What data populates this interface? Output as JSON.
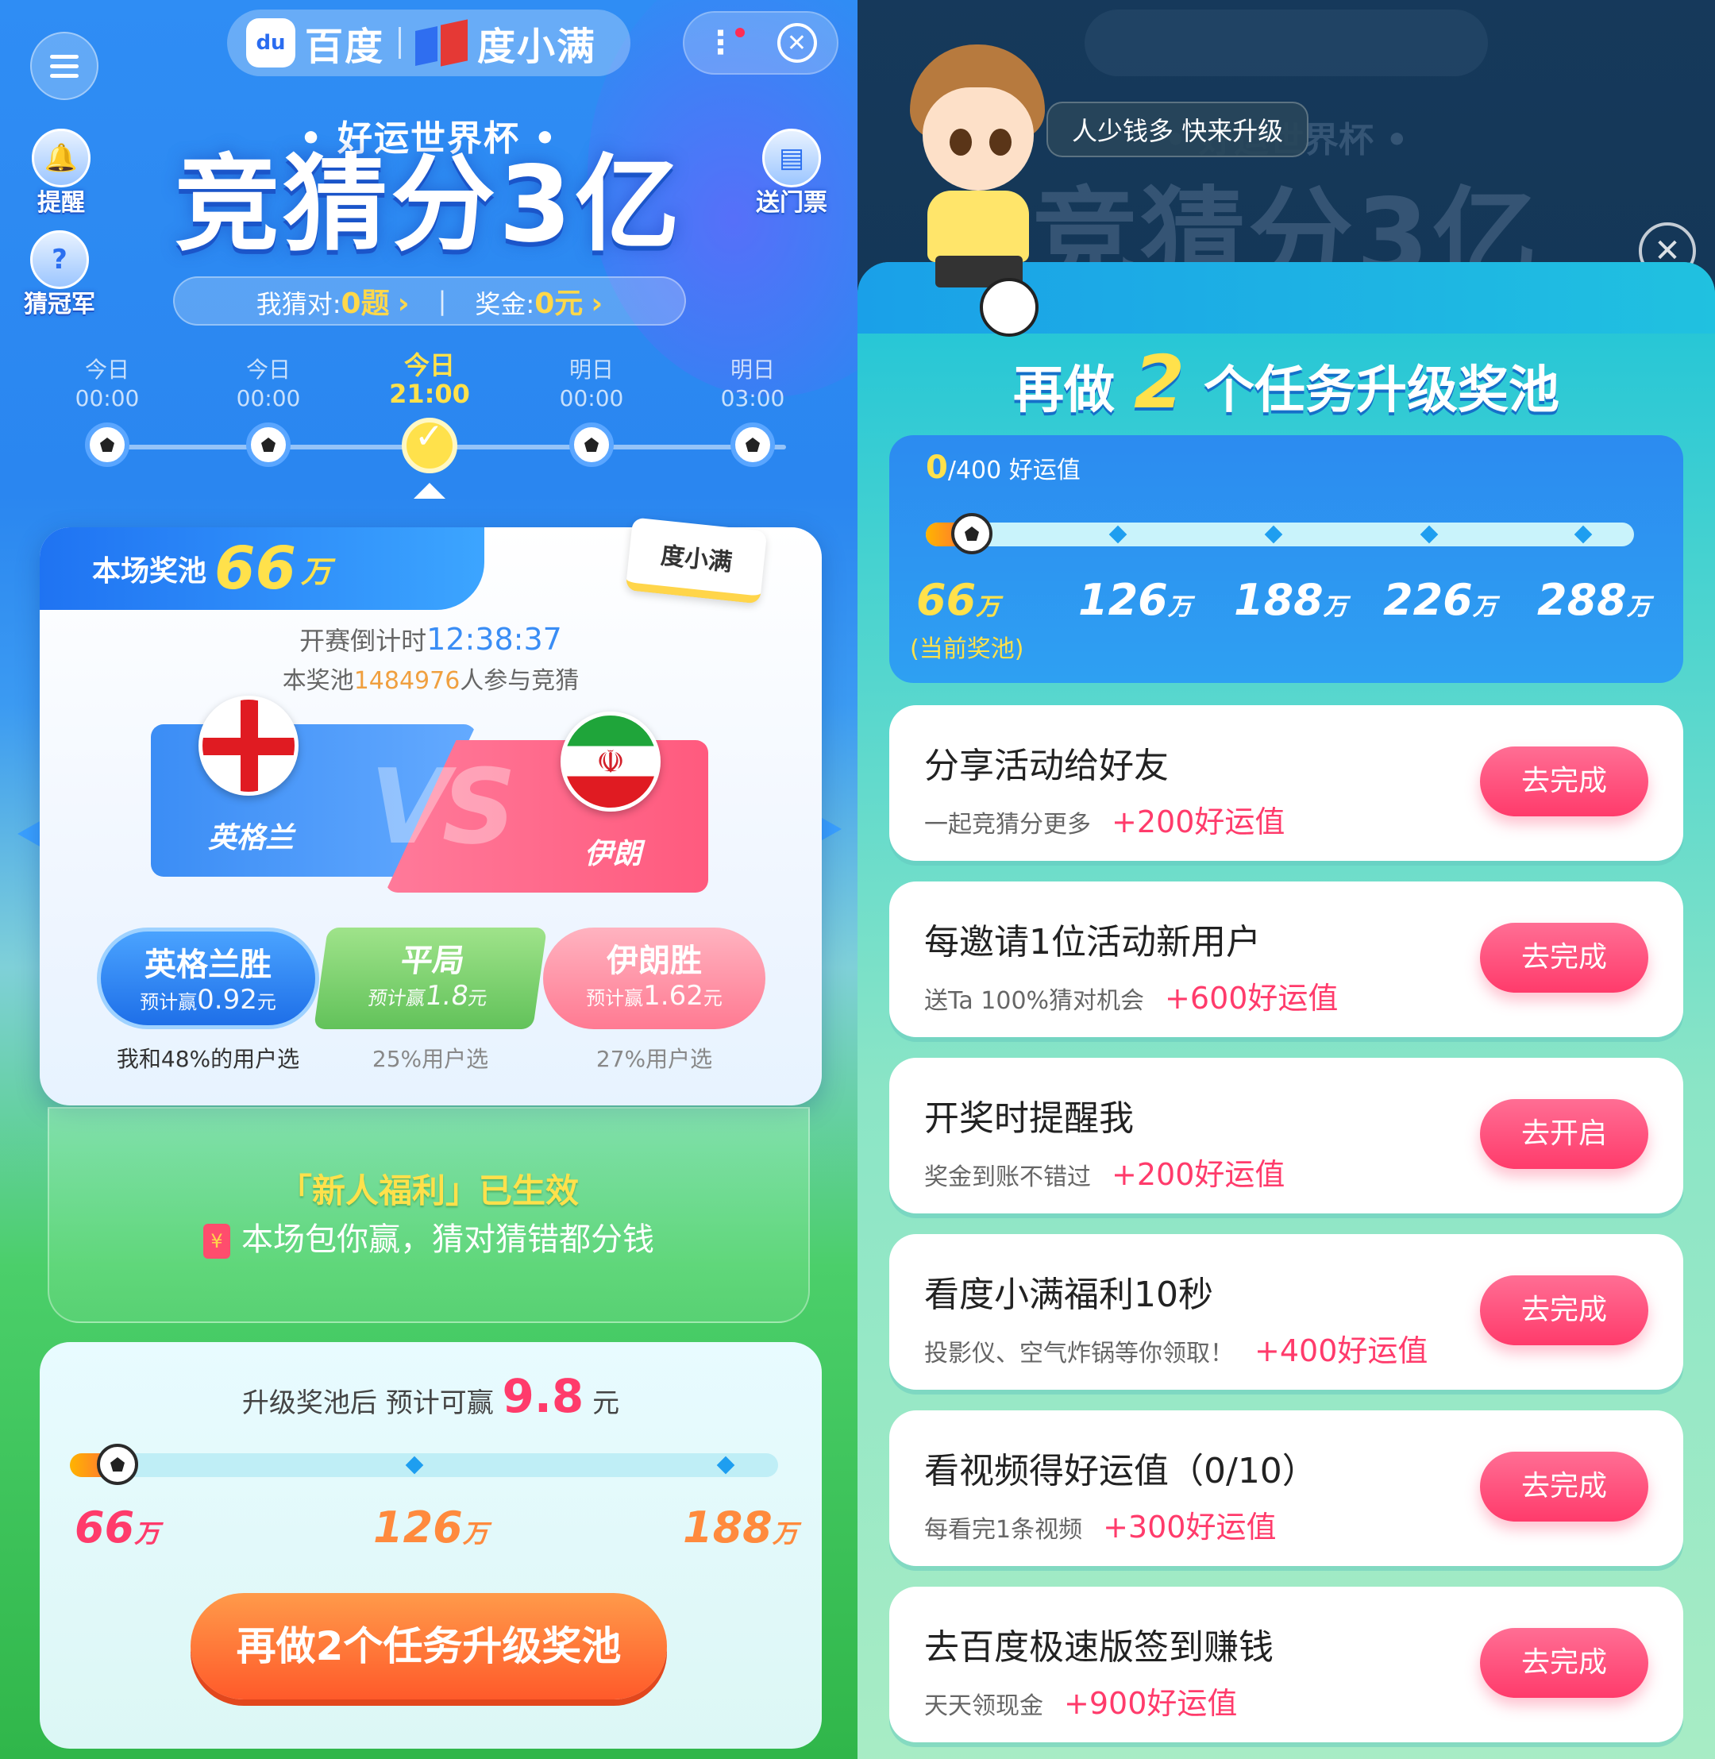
{
  "left": {
    "header": {
      "logo_text": "du",
      "brand_baidu": "百度",
      "brand_dxm": "度小满",
      "menu_dots": "⋮",
      "close_glyph": "✕"
    },
    "side_icons": [
      {
        "label": "提醒",
        "glyph": "🔔"
      },
      {
        "label": "猜冠军",
        "glyph": "?"
      },
      {
        "label": "送门票",
        "glyph": "▤"
      }
    ],
    "subtitle": "• 好运世界杯 •",
    "headline": "竞猜分3亿",
    "stats": {
      "guessed_label": "我猜对:",
      "guessed_value": "0题",
      "prize_label": "奖金:",
      "prize_value": "0元",
      "chevron": "›"
    },
    "timeline": [
      {
        "day": "今日",
        "time": "00:00"
      },
      {
        "day": "今日",
        "time": "00:00"
      },
      {
        "day": "今日",
        "time": "21:00",
        "active": true
      },
      {
        "day": "明日",
        "time": "00:00"
      },
      {
        "day": "明日",
        "time": "03:00"
      }
    ],
    "match": {
      "pool_label": "本场奖池",
      "pool_value": "66",
      "pool_unit": "万",
      "sponsor": "度小满",
      "countdown_label": "开赛倒计时",
      "countdown_value": "12:38:37",
      "participants_prefix": "本奖池",
      "participants_count": "1484976",
      "participants_suffix": "人参与竞猜",
      "home_team": "英格兰",
      "away_team": "伊朗",
      "vs": "VS",
      "iran_emblem": "☫"
    },
    "bets": [
      {
        "label": "英格兰胜",
        "est_prefix": "预计赢",
        "est_value": "0.92",
        "est_unit": "元",
        "share": "我和48%的用户选"
      },
      {
        "label": "平局",
        "est_prefix": "预计赢",
        "est_value": "1.8",
        "est_unit": "元",
        "share": "25%用户选"
      },
      {
        "label": "伊朗胜",
        "est_prefix": "预计赢",
        "est_value": "1.62",
        "est_unit": "元",
        "share": "27%用户选"
      }
    ],
    "newbie": {
      "title": "「新人福利」已生效",
      "envelope": "¥",
      "subtitle": "本场包你赢，猜对猜错都分钱"
    },
    "upgrade": {
      "prefix": "升级奖池后 预计可赢",
      "amount": "9.8",
      "unit": "元",
      "milestones": [
        {
          "value": "66",
          "unit": "万"
        },
        {
          "value": "126",
          "unit": "万"
        },
        {
          "value": "188",
          "unit": "万"
        }
      ],
      "cta": "再做2个任务升级奖池"
    }
  },
  "right": {
    "speech": "人少钱多 快来升级",
    "close_glyph": "✕",
    "sheet_title_prefix": "再做",
    "sheet_title_num": "2",
    "sheet_title_suffix": "个任务升级奖池",
    "progress": {
      "current": "0",
      "total": "/400 好运值",
      "fraction": 0,
      "milestones": [
        {
          "value": "66",
          "unit": "万"
        },
        {
          "value": "126",
          "unit": "万"
        },
        {
          "value": "188",
          "unit": "万"
        },
        {
          "value": "226",
          "unit": "万"
        },
        {
          "value": "288",
          "unit": "万"
        }
      ],
      "current_note": "(当前奖池)"
    },
    "tasks": [
      {
        "title": "分享活动给好友",
        "desc": "一起竞猜分更多",
        "points": "+200好运值",
        "button": "去完成"
      },
      {
        "title": "每邀请1位活动新用户",
        "desc": "送Ta 100%猜对机会",
        "points": "+600好运值",
        "button": "去完成"
      },
      {
        "title": "开奖时提醒我",
        "desc": "奖金到账不错过",
        "points": "+200好运值",
        "button": "去开启"
      },
      {
        "title": "看度小满福利10秒",
        "desc": "投影仪、空气炸锅等你领取！",
        "points": "+400好运值",
        "button": "去完成"
      },
      {
        "title": "看视频得好运值（0/10）",
        "desc": "每看完1条视频",
        "points": "+300好运值",
        "button": "去完成"
      },
      {
        "title": "去百度极速版签到赚钱",
        "desc": "天天领现金",
        "points": "+900好运值",
        "button": "去完成"
      }
    ]
  },
  "colors": {
    "accent_blue": "#2f8df4",
    "gold": "#ffe14b",
    "pink_button": "#ff3b6b",
    "cta_orange": "#ff6a3d",
    "green": "#30b64a"
  }
}
